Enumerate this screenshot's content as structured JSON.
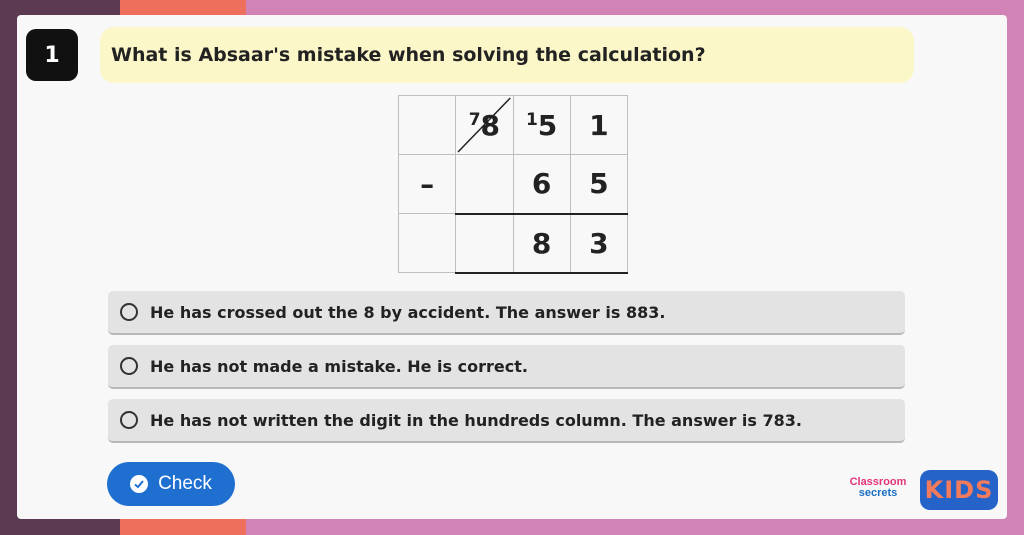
{
  "question": {
    "number": "1",
    "text": "What is Absaar's mistake when solving the calculation?"
  },
  "calculation": {
    "row1": {
      "c1": "",
      "c2_sup": "7",
      "c2": "8",
      "c3_sup": "1",
      "c3": "5",
      "c4": "1"
    },
    "row2": {
      "c1": "–",
      "c2": "",
      "c3": "6",
      "c4": "5"
    },
    "row3": {
      "c1": "",
      "c2": "",
      "c3": "8",
      "c4": "3"
    }
  },
  "options": [
    {
      "label": "He has crossed out the 8 by accident. The answer is 883."
    },
    {
      "label": "He has not made a mistake. He is correct."
    },
    {
      "label": "He has not written the digit in the hundreds column. The answer is 783."
    }
  ],
  "check_button": {
    "label": "Check"
  },
  "branding": {
    "logo_line1": "Classroom",
    "logo_line2": "secrets",
    "kids": "KIDS"
  },
  "colors": {
    "accent": "#1f6fd1",
    "question_bg": "#fbf7c8",
    "background": "#d183b5"
  }
}
